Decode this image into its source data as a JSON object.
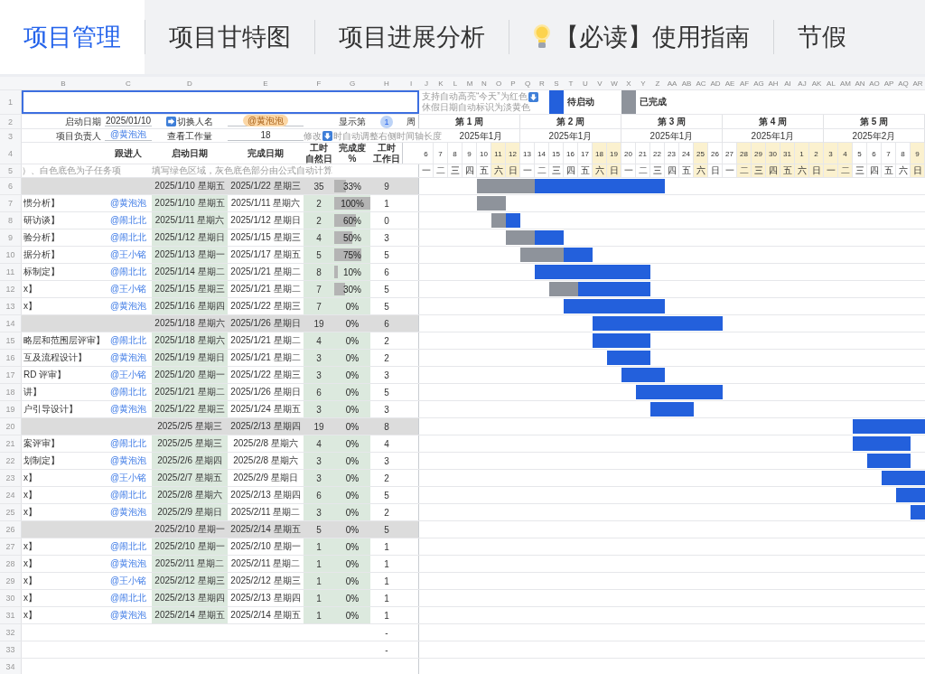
{
  "tabs": [
    {
      "label": "项目管理",
      "selected": true,
      "kind": "text"
    },
    {
      "label": "项目甘特图",
      "selected": false,
      "kind": "text"
    },
    {
      "label": "项目进展分析",
      "selected": false,
      "kind": "text"
    },
    {
      "label": "【必读】使用指南",
      "selected": false,
      "kind": "guide"
    },
    {
      "label": "节假",
      "selected": false,
      "kind": "text"
    }
  ],
  "column_letters": {
    "left": [
      "B",
      "C",
      "D",
      "E",
      "F",
      "G",
      "H",
      "I"
    ],
    "gantt": [
      "J",
      "K",
      "L",
      "M",
      "N",
      "O",
      "P",
      "Q",
      "R",
      "S",
      "T",
      "U",
      "V",
      "W",
      "X",
      "Y",
      "Z",
      "AA",
      "AB",
      "AC",
      "AD",
      "AE",
      "AF",
      "AG",
      "AH",
      "AI",
      "AJ",
      "AK",
      "AL",
      "AM",
      "AN",
      "AO",
      "AP",
      "AQ",
      "AR"
    ]
  },
  "row_numbers": [
    "1",
    "2",
    "3",
    "4",
    "5",
    "6",
    "7",
    "8",
    "9",
    "10",
    "11",
    "12",
    "13",
    "14",
    "15",
    "16",
    "17",
    "18",
    "19",
    "20",
    "21",
    "22",
    "23",
    "24",
    "25",
    "26",
    "27",
    "28",
    "29",
    "30",
    "31",
    "32",
    "33",
    "34"
  ],
  "title_cell": {
    "selected": true
  },
  "settings": {
    "start_label": "启动日期",
    "start_value": "2025/01/10",
    "switch_label": "切换人名",
    "switch_value": "@黄泡泡",
    "show_label": "显示第",
    "show_week": "1",
    "week_unit": "周",
    "owner_label": "项目负责人",
    "owner_value": "@黄泡泡",
    "workload_label": "查看工作量",
    "workload_value": "18",
    "hint_before": "修改",
    "hint_after": "时自动调整右侧时间轴长度"
  },
  "columns": [
    [
      "跟进人"
    ],
    [
      "启动日期"
    ],
    [
      "完成日期"
    ],
    [
      "工时",
      "自然日"
    ],
    [
      "完成度 %"
    ],
    [
      "工时",
      "工作日"
    ]
  ],
  "notes": {
    "left": "）、白色底色为子任务项",
    "right": "填写绿色区域，灰色底色部分由公式自动计算"
  },
  "gantt_header": {
    "today_note": "支持自动高亮“今天”为红色",
    "holiday_note": "休假日期自动标识为淡黄色",
    "legend": [
      {
        "label": "待启动",
        "color": "#2360dc"
      },
      {
        "label": "已完成",
        "color": "#8e939b"
      }
    ],
    "weeks": [
      {
        "label": "第 1 周",
        "month": "2025年1月",
        "days": [
          {
            "day": "6",
            "weekday": "一",
            "holiday": false
          },
          {
            "day": "7",
            "weekday": "二",
            "holiday": false
          },
          {
            "day": "8",
            "weekday": "三",
            "holiday": false
          },
          {
            "day": "9",
            "weekday": "四",
            "holiday": false
          },
          {
            "day": "10",
            "weekday": "五",
            "holiday": false
          },
          {
            "day": "11",
            "weekday": "六",
            "holiday": true
          },
          {
            "day": "12",
            "weekday": "日",
            "holiday": true
          }
        ]
      },
      {
        "label": "第 2 周",
        "month": "2025年1月",
        "days": [
          {
            "day": "13",
            "weekday": "一",
            "holiday": false
          },
          {
            "day": "14",
            "weekday": "二",
            "holiday": false
          },
          {
            "day": "15",
            "weekday": "三",
            "holiday": false
          },
          {
            "day": "16",
            "weekday": "四",
            "holiday": false
          },
          {
            "day": "17",
            "weekday": "五",
            "holiday": false
          },
          {
            "day": "18",
            "weekday": "六",
            "holiday": true
          },
          {
            "day": "19",
            "weekday": "日",
            "holiday": true
          }
        ]
      },
      {
        "label": "第 3 周",
        "month": "2025年1月",
        "days": [
          {
            "day": "20",
            "weekday": "一",
            "holiday": false
          },
          {
            "day": "21",
            "weekday": "二",
            "holiday": false
          },
          {
            "day": "22",
            "weekday": "三",
            "holiday": false
          },
          {
            "day": "23",
            "weekday": "四",
            "holiday": false
          },
          {
            "day": "24",
            "weekday": "五",
            "holiday": false
          },
          {
            "day": "25",
            "weekday": "六",
            "holiday": true
          },
          {
            "day": "26",
            "weekday": "日",
            "holiday": false
          }
        ]
      },
      {
        "label": "第 4 周",
        "month": "2025年1月",
        "days": [
          {
            "day": "27",
            "weekday": "一",
            "holiday": false
          },
          {
            "day": "28",
            "weekday": "二",
            "holiday": true
          },
          {
            "day": "29",
            "weekday": "三",
            "holiday": true
          },
          {
            "day": "30",
            "weekday": "四",
            "holiday": true
          },
          {
            "day": "31",
            "weekday": "五",
            "holiday": true
          },
          {
            "day": "1",
            "weekday": "六",
            "holiday": true
          },
          {
            "day": "2",
            "weekday": "日",
            "holiday": true
          }
        ]
      },
      {
        "label": "第 5 周",
        "month": "2025年2月",
        "days": [
          {
            "day": "3",
            "weekday": "一",
            "holiday": true
          },
          {
            "day": "4",
            "weekday": "二",
            "holiday": true
          },
          {
            "day": "5",
            "weekday": "三",
            "holiday": false
          },
          {
            "day": "6",
            "weekday": "四",
            "holiday": false
          },
          {
            "day": "7",
            "weekday": "五",
            "holiday": false
          },
          {
            "day": "8",
            "weekday": "六",
            "holiday": false
          },
          {
            "day": "9",
            "weekday": "日",
            "holiday": true
          }
        ]
      }
    ]
  },
  "rows": [
    {
      "kind": "group",
      "start": "2025/1/10 星期五",
      "end": "2025/1/22 星期三",
      "natural_days": "35",
      "progress": "33%",
      "level": 0.33,
      "work_days": "9"
    },
    {
      "kind": "task",
      "name": "惯分析】",
      "owner": "@黄泡泡",
      "start": "2025/1/10 星期五",
      "end": "2025/1/11 星期六",
      "natural_days": "2",
      "progress": "100%",
      "level": 1,
      "work_days": "1"
    },
    {
      "kind": "task",
      "name": "研访谈】",
      "owner": "@闹北北",
      "start": "2025/1/11 星期六",
      "end": "2025/1/12 星期日",
      "natural_days": "2",
      "progress": "60%",
      "level": 0.6,
      "work_days": "0"
    },
    {
      "kind": "task",
      "name": "验分析】",
      "owner": "@闹北北",
      "start": "2025/1/12 星期日",
      "end": "2025/1/15 星期三",
      "natural_days": "4",
      "progress": "50%",
      "level": 0.5,
      "work_days": "3"
    },
    {
      "kind": "task",
      "name": "据分析】",
      "owner": "@王小铭",
      "start": "2025/1/13 星期一",
      "end": "2025/1/17 星期五",
      "natural_days": "5",
      "progress": "75%",
      "level": 0.75,
      "work_days": "5"
    },
    {
      "kind": "task",
      "name": "标制定】",
      "owner": "@闹北北",
      "start": "2025/1/14 星期二",
      "end": "2025/1/21 星期二",
      "natural_days": "8",
      "progress": "10%",
      "level": 0.1,
      "work_days": "6"
    },
    {
      "kind": "task",
      "name": "x】",
      "owner": "@王小铭",
      "start": "2025/1/15 星期三",
      "end": "2025/1/21 星期二",
      "natural_days": "7",
      "progress": "30%",
      "level": 0.3,
      "work_days": "5"
    },
    {
      "kind": "task",
      "name": "x】",
      "owner": "@黄泡泡",
      "start": "2025/1/16 星期四",
      "end": "2025/1/22 星期三",
      "natural_days": "7",
      "progress": "0%",
      "work_days": "5"
    },
    {
      "kind": "group",
      "start": "2025/1/18 星期六",
      "end": "2025/1/26 星期日",
      "natural_days": "19",
      "progress": "0%",
      "work_days": "6"
    },
    {
      "kind": "task",
      "name": "略层和范围层评审】",
      "owner": "@闹北北",
      "start": "2025/1/18 星期六",
      "end": "2025/1/21 星期二",
      "natural_days": "4",
      "progress": "0%",
      "work_days": "2"
    },
    {
      "kind": "task",
      "name": "互及流程设计】",
      "owner": "@黄泡泡",
      "start": "2025/1/19 星期日",
      "end": "2025/1/21 星期二",
      "natural_days": "3",
      "progress": "0%",
      "work_days": "2"
    },
    {
      "kind": "task",
      "name": "RD 评审】",
      "owner": "@王小铭",
      "start": "2025/1/20 星期一",
      "end": "2025/1/22 星期三",
      "natural_days": "3",
      "progress": "0%",
      "work_days": "3"
    },
    {
      "kind": "task",
      "name": "讲】",
      "owner": "@闹北北",
      "start": "2025/1/21 星期二",
      "end": "2025/1/26 星期日",
      "natural_days": "6",
      "progress": "0%",
      "work_days": "5"
    },
    {
      "kind": "task",
      "name": "户引导设计】",
      "owner": "@黄泡泡",
      "start": "2025/1/22 星期三",
      "end": "2025/1/24 星期五",
      "natural_days": "3",
      "progress": "0%",
      "work_days": "3"
    },
    {
      "kind": "group",
      "start": "2025/2/5 星期三",
      "end": "2025/2/13 星期四",
      "natural_days": "19",
      "progress": "0%",
      "work_days": "8"
    },
    {
      "kind": "task",
      "name": "案评审】",
      "owner": "@闹北北",
      "start": "2025/2/5 星期三",
      "end": "2025/2/8 星期六",
      "natural_days": "4",
      "progress": "0%",
      "work_days": "4"
    },
    {
      "kind": "task",
      "name": "划制定】",
      "owner": "@黄泡泡",
      "start": "2025/2/6 星期四",
      "end": "2025/2/8 星期六",
      "natural_days": "3",
      "progress": "0%",
      "work_days": "3"
    },
    {
      "kind": "task",
      "name": "x】",
      "owner": "@王小铭",
      "start": "2025/2/7 星期五",
      "end": "2025/2/9 星期日",
      "natural_days": "3",
      "progress": "0%",
      "work_days": "2"
    },
    {
      "kind": "task",
      "name": "x】",
      "owner": "@闹北北",
      "start": "2025/2/8 星期六",
      "end": "2025/2/13 星期四",
      "natural_days": "6",
      "progress": "0%",
      "work_days": "5"
    },
    {
      "kind": "task",
      "name": "x】",
      "owner": "@黄泡泡",
      "start": "2025/2/9 星期日",
      "end": "2025/2/11 星期二",
      "natural_days": "3",
      "progress": "0%",
      "work_days": "2"
    },
    {
      "kind": "group",
      "start": "2025/2/10 星期一",
      "end": "2025/2/14 星期五",
      "natural_days": "5",
      "progress": "0%",
      "work_days": "5"
    },
    {
      "kind": "task",
      "name": "x】",
      "owner": "@闹北北",
      "start": "2025/2/10 星期一",
      "end": "2025/2/10 星期一",
      "natural_days": "1",
      "progress": "0%",
      "work_days": "1"
    },
    {
      "kind": "task",
      "name": "x】",
      "owner": "@黄泡泡",
      "start": "2025/2/11 星期二",
      "end": "2025/2/11 星期二",
      "natural_days": "1",
      "progress": "0%",
      "work_days": "1"
    },
    {
      "kind": "task",
      "name": "x】",
      "owner": "@王小铭",
      "start": "2025/2/12 星期三",
      "end": "2025/2/12 星期三",
      "natural_days": "1",
      "progress": "0%",
      "work_days": "1"
    },
    {
      "kind": "task",
      "name": "x】",
      "owner": "@闹北北",
      "start": "2025/2/13 星期四",
      "end": "2025/2/13 星期四",
      "natural_days": "1",
      "progress": "0%",
      "work_days": "1"
    },
    {
      "kind": "task",
      "name": "x】",
      "owner": "@黄泡泡",
      "start": "2025/2/14 星期五",
      "end": "2025/2/14 星期五",
      "natural_days": "1",
      "progress": "0%",
      "work_days": "1"
    },
    {
      "kind": "blank",
      "work_days": "-"
    },
    {
      "kind": "blank",
      "work_days": "-"
    },
    {
      "kind": "blank"
    }
  ]
}
